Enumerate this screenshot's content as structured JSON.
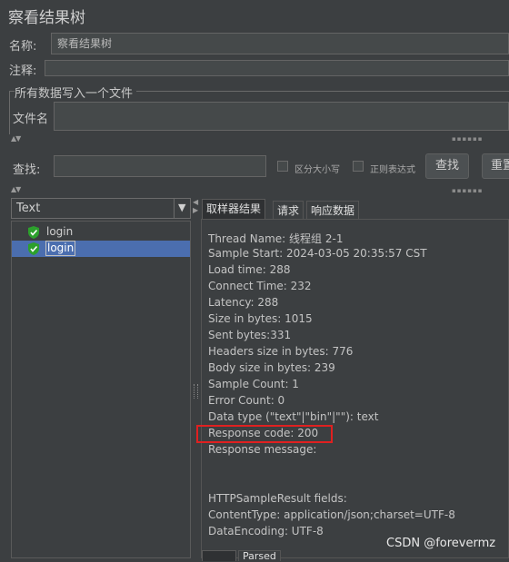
{
  "window": {
    "title": "察看结果树"
  },
  "name_field": {
    "label": "名称:",
    "value": "察看结果树"
  },
  "comment_field": {
    "label": "注释:",
    "value": ""
  },
  "file_section": {
    "legend": "所有数据写入一个文件",
    "label": "文件名",
    "value": ""
  },
  "search": {
    "label": "查找:",
    "value": "",
    "case_sensitive_label": "区分大小写",
    "regex_label": "正则表达式",
    "find_button": "查找",
    "reset_button": "重置"
  },
  "renderer": {
    "selected": "Text"
  },
  "tree": {
    "items": [
      {
        "label": "login",
        "status": "success",
        "selected": false
      },
      {
        "label": "login",
        "status": "success",
        "selected": true
      }
    ]
  },
  "tabs": [
    {
      "label": "取样器结果",
      "active": true
    },
    {
      "label": "请求",
      "active": false
    },
    {
      "label": "响应数据",
      "active": false
    }
  ],
  "bottom_tabs": [
    {
      "label": "",
      "active": true
    },
    {
      "label": "Parsed",
      "active": false
    }
  ],
  "sampler_result": [
    "Thread Name: 线程组 2-1",
    "Sample Start: 2024-03-05 20:35:57 CST",
    "Load time: 288",
    "Connect Time: 232",
    "Latency: 288",
    "Size in bytes: 1015",
    "Sent bytes:331",
    "Headers size in bytes: 776",
    "Body size in bytes: 239",
    "Sample Count: 1",
    "Error Count: 0",
    "Data type (\"text\"|\"bin\"|\"\"): text",
    "Response code: 200",
    "Response message:",
    "",
    "",
    "HTTPSampleResult fields:",
    "ContentType: application/json;charset=UTF-8",
    "DataEncoding: UTF-8"
  ],
  "highlight": {
    "color": "#e02020",
    "line_index": 12
  },
  "watermark": "CSDN @forevermz",
  "colors": {
    "background": "#3c3f41",
    "selection": "#4b6eaf",
    "success_icon": "#2ca02c"
  }
}
